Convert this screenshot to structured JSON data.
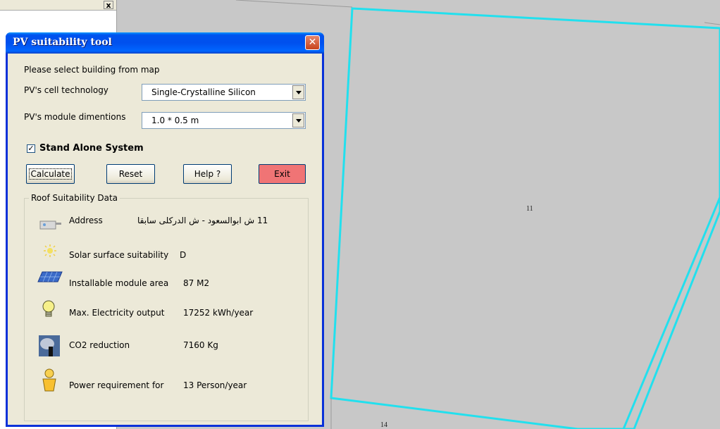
{
  "window": {
    "title": "PV suitability tool",
    "close_glyph": "✕"
  },
  "form": {
    "instruction": "Please select building from map",
    "cell_tech_label": "PV's cell technology",
    "cell_tech_value": "Single-Crystalline Silicon",
    "module_dim_label": "PV's module dimentions",
    "module_dim_value": "1.0 * 0.5 m",
    "standalone_label": "Stand Alone System",
    "standalone_checked": true
  },
  "buttons": {
    "calculate": "Calculate",
    "reset": "Reset",
    "help": "Help ?",
    "exit": "Exit"
  },
  "results": {
    "group_title": "Roof Suitability Data",
    "address_label": "Address",
    "address_value": "11 ش ابوالسعود - ش الدركلى سابقا",
    "solar_label": "Solar surface suitability",
    "solar_value": "D",
    "area_label": "Installable module area",
    "area_value": "87 M2",
    "electricity_label": "Max. Electricity output",
    "electricity_value": "17252 kWh/year",
    "co2_label": "CO2 reduction",
    "co2_value": "7160 Kg",
    "power_label": "Power requirement for",
    "power_value": "13 Person/year"
  },
  "map": {
    "parcel_label_a": "11",
    "parcel_label_b": "14",
    "highlight_color": "#22e0ee",
    "parcel_fill": "#cccccc"
  },
  "icons": {
    "address": "mailbox-icon",
    "solar": "sun-icon",
    "area": "solar-panel-icon",
    "electricity": "lightbulb-icon",
    "co2": "smokestack-icon",
    "power": "person-icon"
  }
}
